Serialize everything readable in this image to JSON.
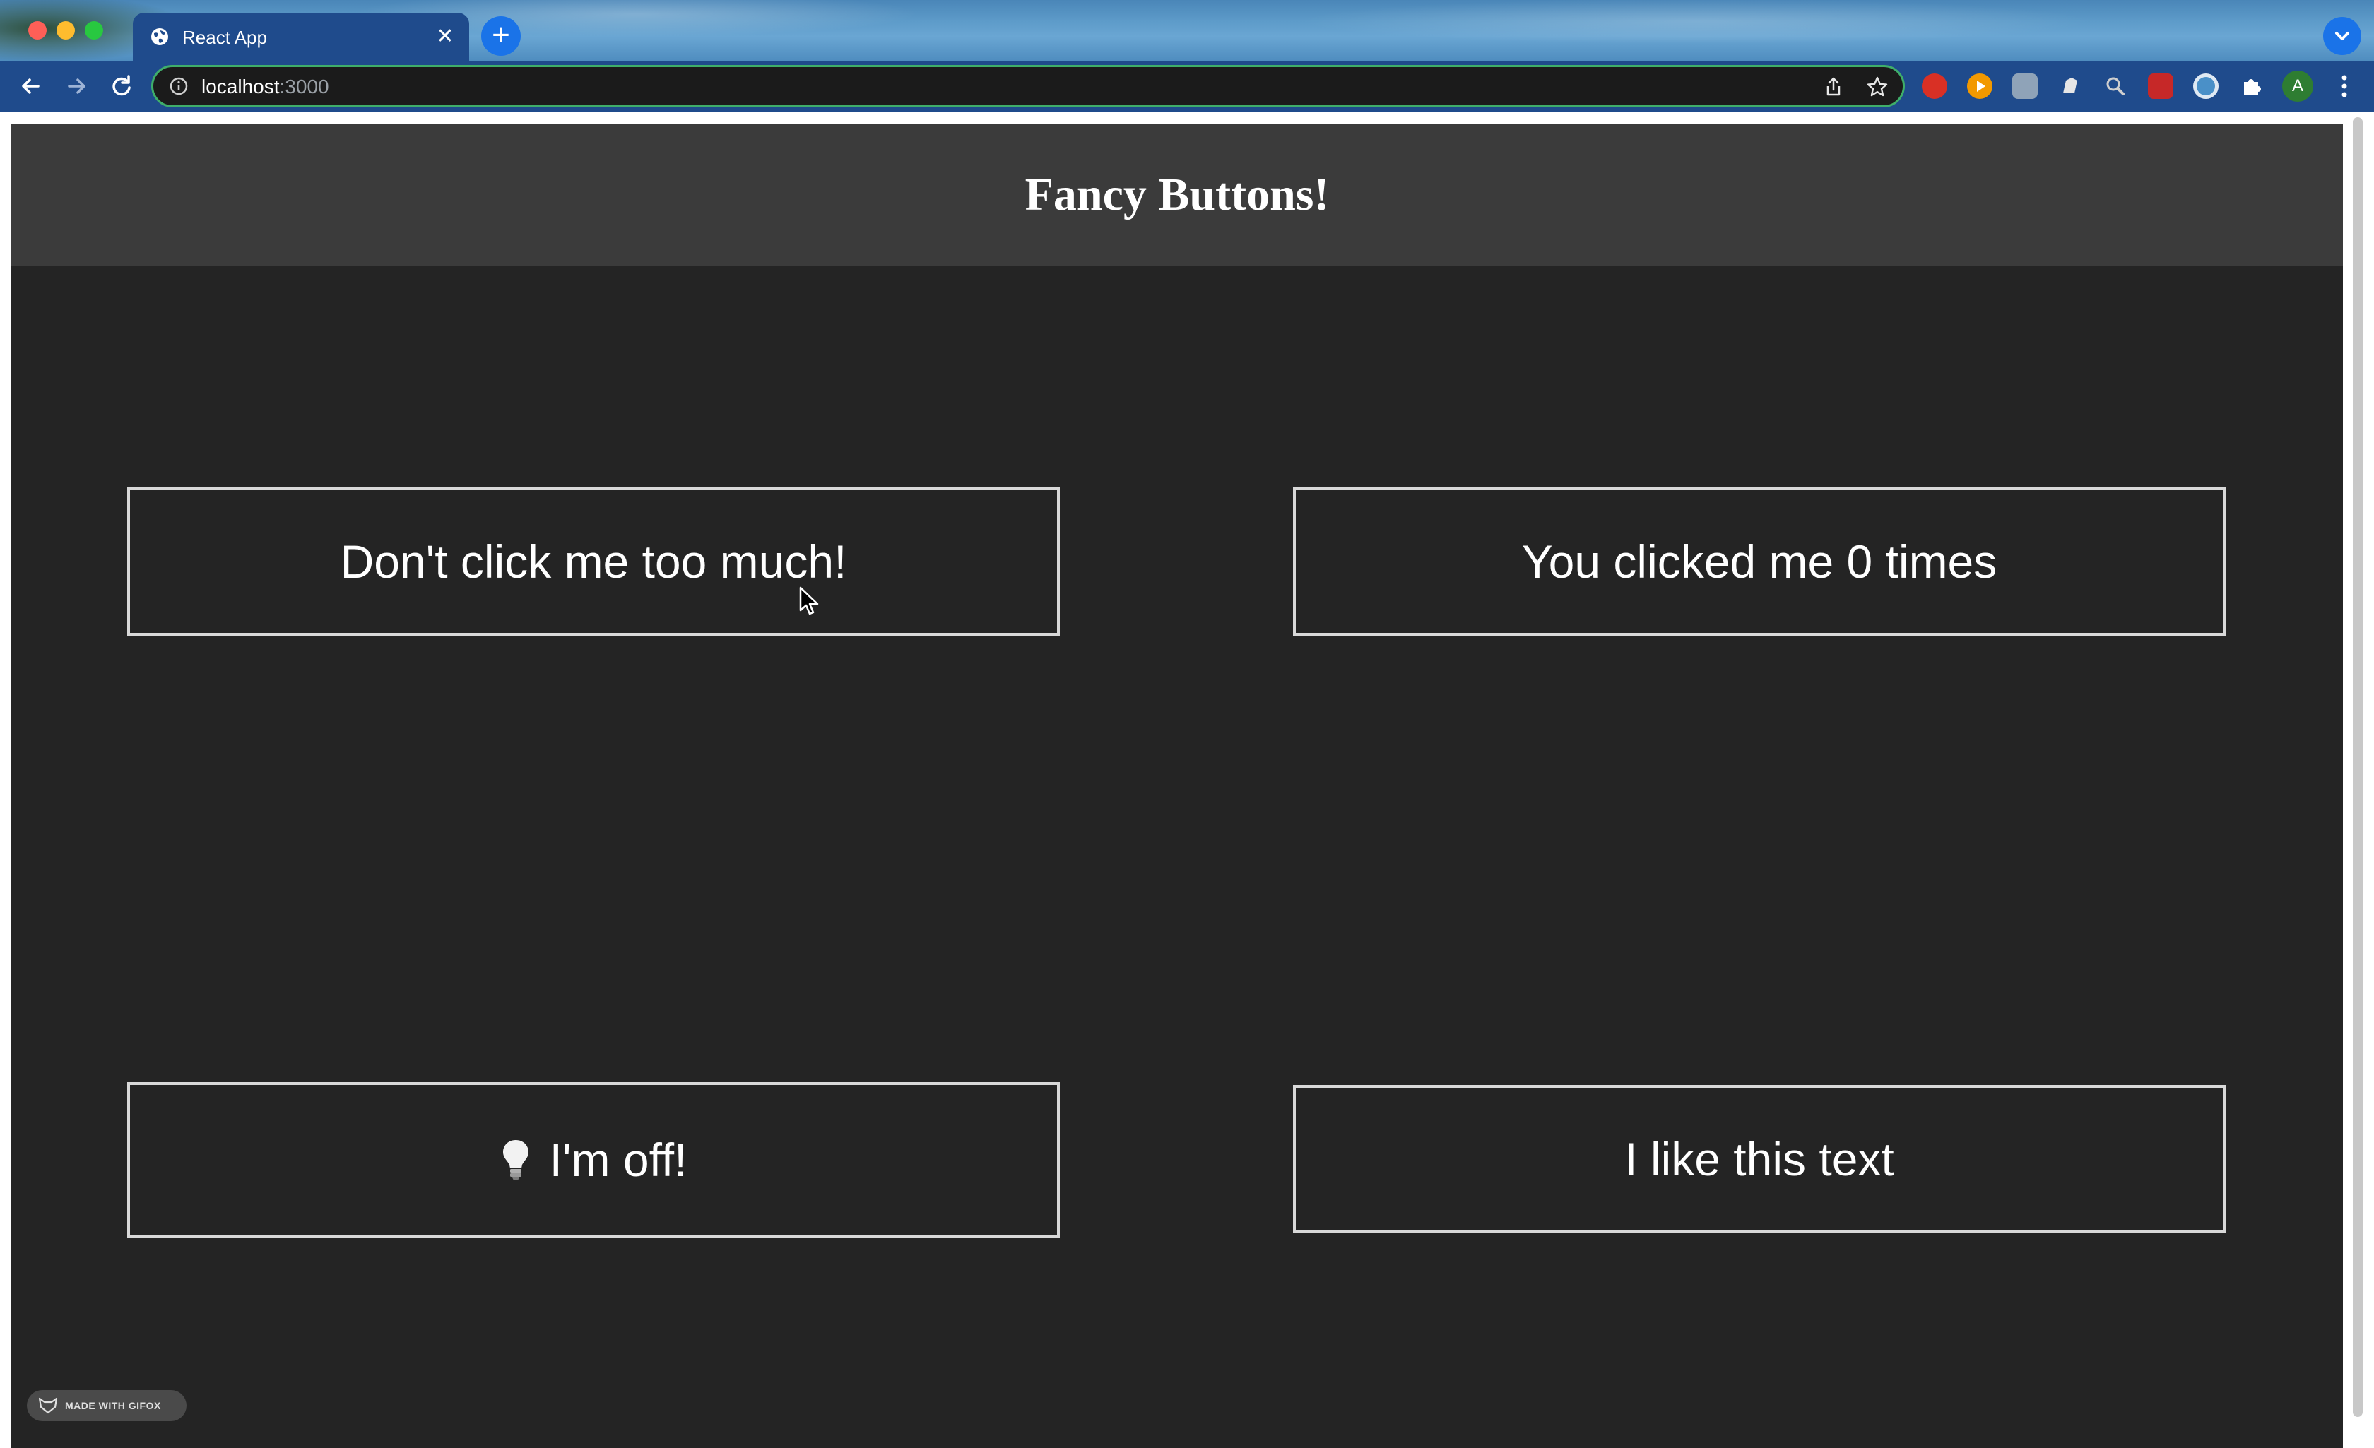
{
  "browser": {
    "tab": {
      "title": "React App",
      "favicon": "globe-icon",
      "close_icon": "close-icon"
    },
    "new_tab_icon": "plus-icon",
    "address_bar": {
      "host": "localhost",
      "port": ":3000"
    },
    "profile_initial": "A",
    "extensions": [
      "adblock-icon",
      "play-icon",
      "extension-box-icon",
      "pencil-icon",
      "magnifier-icon",
      "gift-icon",
      "circle-icon",
      "puzzle-icon"
    ]
  },
  "page": {
    "title": "Fancy Buttons!",
    "buttons": {
      "dont_click": "Don't click me too much!",
      "counter": "You clicked me 0 times",
      "light": "I'm off!",
      "like_text": "I like this text"
    },
    "badge": "MADE WITH GIFOX"
  },
  "colors": {
    "app_bg": "#242424",
    "header_bg": "#3b3b3b",
    "button_border": "#d8d8d8",
    "chrome_toolbar": "#1f4b8c",
    "omnibox_focus": "#3fae6a"
  }
}
